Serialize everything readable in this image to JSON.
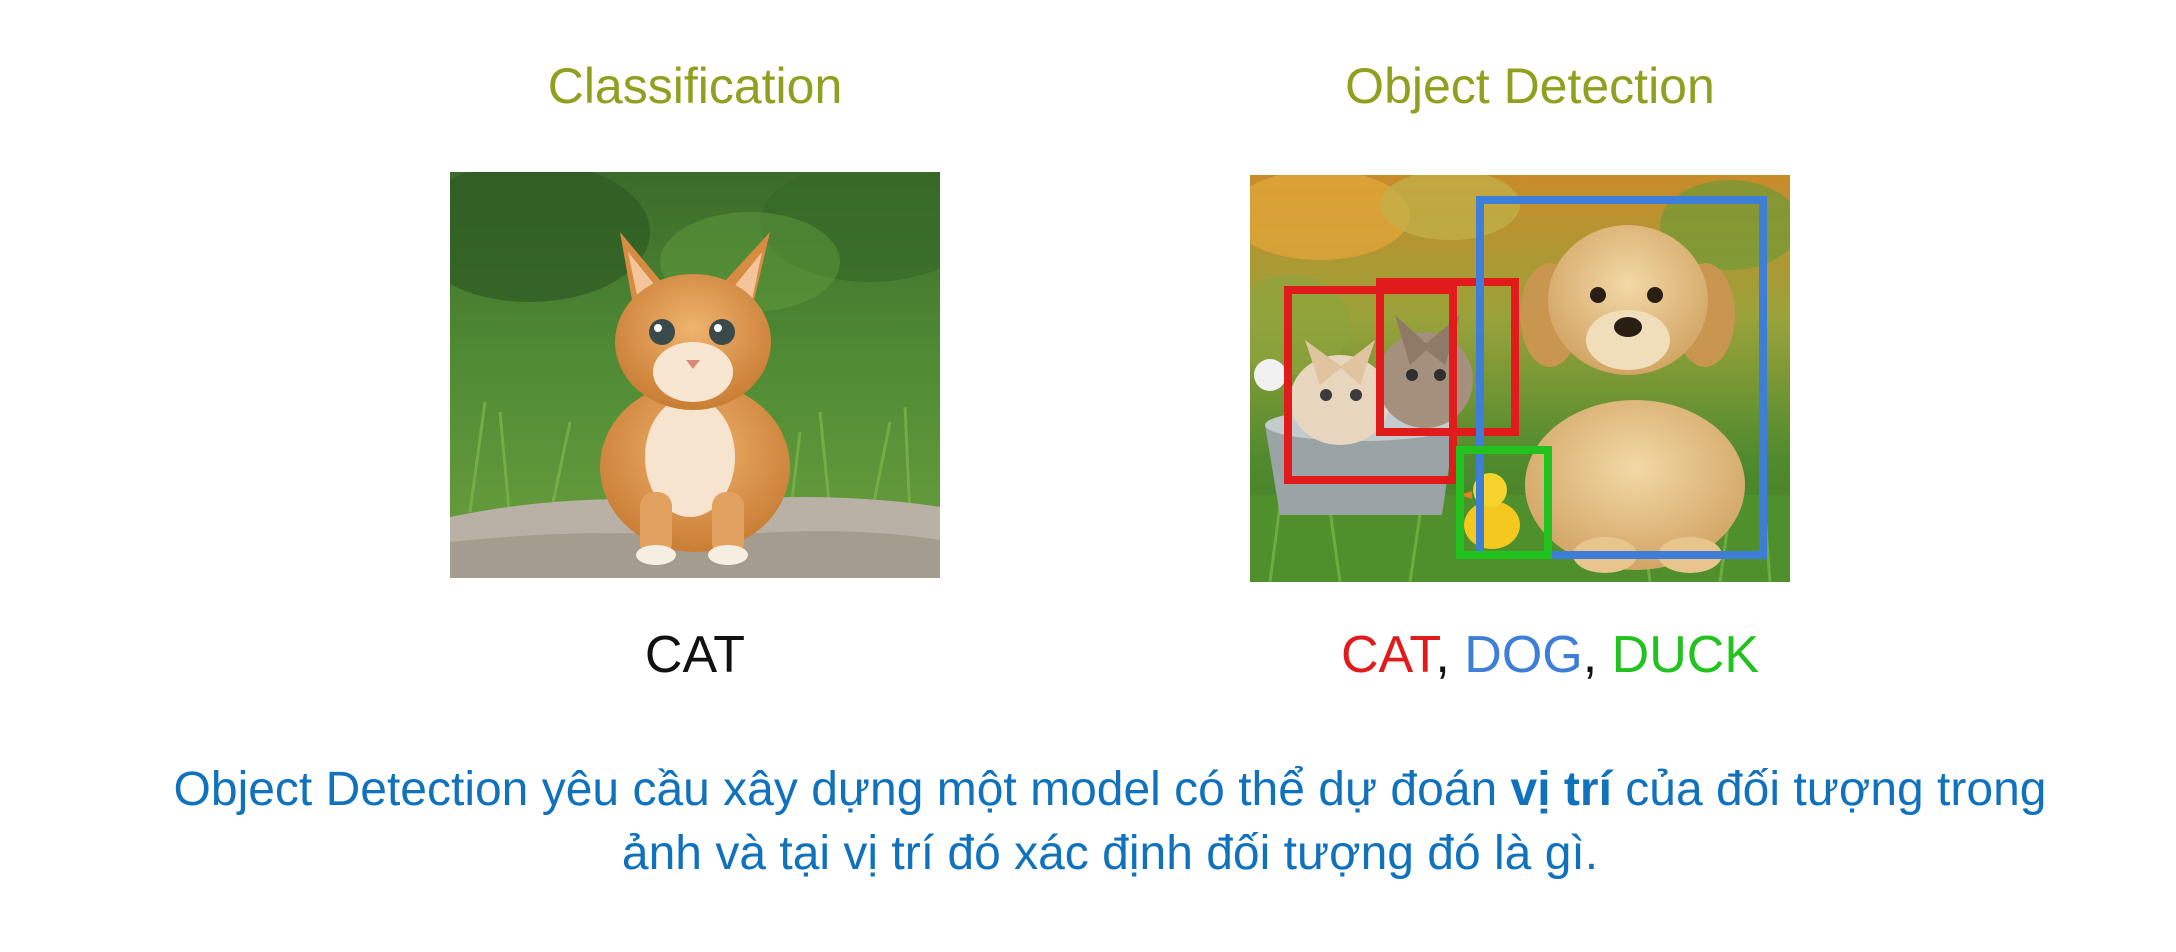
{
  "headings": {
    "left": "Classification",
    "right": "Object Detection"
  },
  "captions": {
    "left": "CAT",
    "right": {
      "cat": "CAT",
      "dog": "DOG",
      "duck": "DUCK",
      "separator": ","
    }
  },
  "description": {
    "line1_before": "Object Detection yêu cầu xây dựng một model có thể dự đoán ",
    "line1_bold": "vị trí",
    "line1_after": " của đối tượng trong",
    "line2": "ảnh và tại vị trí đó xác định đối tượng đó là gì."
  },
  "colors": {
    "heading": "#8fa01e",
    "description": "#1072bd",
    "cat_box": "#e11b1b",
    "dog_box": "#3e7ed8",
    "duck_box": "#22c21f"
  }
}
